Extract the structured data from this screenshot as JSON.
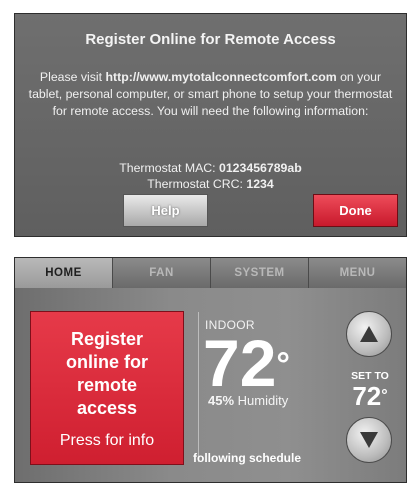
{
  "dialog": {
    "title": "Register Online for Remote Access",
    "text_before_url": "Please visit ",
    "url": "http://www.mytotalconnectcomfort.com",
    "text_after_url": " on your tablet, personal computer, or smart phone to setup your thermostat for remote access.  You will need the following information:",
    "mac_label": "Thermostat MAC: ",
    "mac_value": "0123456789ab",
    "crc_label": "Thermostat CRC: ",
    "crc_value": "1234",
    "help_label": "Help",
    "done_label": "Done",
    "colors": {
      "done_button": "#d9253a",
      "help_button": "#c8c8c8",
      "background": "#666666"
    }
  },
  "home": {
    "tabs": [
      {
        "label": "HOME",
        "active": true
      },
      {
        "label": "FAN",
        "active": false
      },
      {
        "label": "SYSTEM",
        "active": false
      },
      {
        "label": "MENU",
        "active": false
      }
    ],
    "register_button": {
      "line1": "Register",
      "line2": "online for",
      "line3": "remote",
      "line4": "access",
      "sub": "Press for info"
    },
    "indoor_label": "INDOOR",
    "indoor_temp": "72",
    "degree_symbol": "°",
    "humidity_value": "45%",
    "humidity_label": " Humidity",
    "schedule_text": "following schedule",
    "set_to_label": "SET TO",
    "set_temp": "72",
    "up_icon": "triangle-up-icon",
    "down_icon": "triangle-down-icon",
    "colors": {
      "register_button": "#d9253a",
      "background": "#7f7f7f"
    }
  }
}
